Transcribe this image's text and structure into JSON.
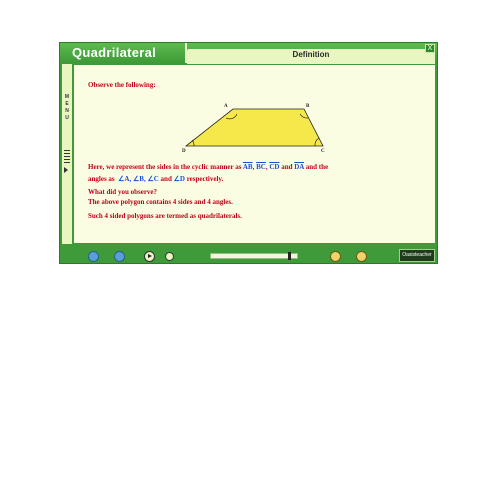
{
  "window": {
    "title": "Quadrilateral",
    "close_label": "X"
  },
  "section": {
    "label": "Definition"
  },
  "sidebar": {
    "letters": [
      "M",
      "E",
      "N",
      "U"
    ]
  },
  "content": {
    "observe": "Observe the following:",
    "figure": {
      "vertices": [
        "A",
        "B",
        "C",
        "D"
      ]
    },
    "line1_prefix": "Here, we represent the sides in the cyclic manner as",
    "sides": [
      "AB",
      "BC",
      "CD",
      "DA"
    ],
    "comma": ",",
    "and_word": "and",
    "line1_suffix": "and the",
    "line2_prefix": "angles as",
    "angles": [
      "∠A,",
      "∠B,",
      "∠C",
      "∠D"
    ],
    "line2_suffix": "respectively.",
    "question": "What did you observe?",
    "answer": "The above polygon contains 4 sides and 4 angles.",
    "conclusion": "Such 4 sided polygons are termed as quadrilaterals."
  },
  "bottom": {
    "brand": "Oasisteacher",
    "progress": 0.93
  },
  "colors": {
    "frame": "#3f9a3a",
    "panel": "#fbfde3",
    "shape_fill": "#f6e84a",
    "text_red": "#c0001a",
    "text_blue": "#1a4fd6"
  },
  "icons": [
    "back-icon",
    "refresh-icon",
    "play-icon",
    "info-icon",
    "help-icon",
    "exit-icon"
  ]
}
